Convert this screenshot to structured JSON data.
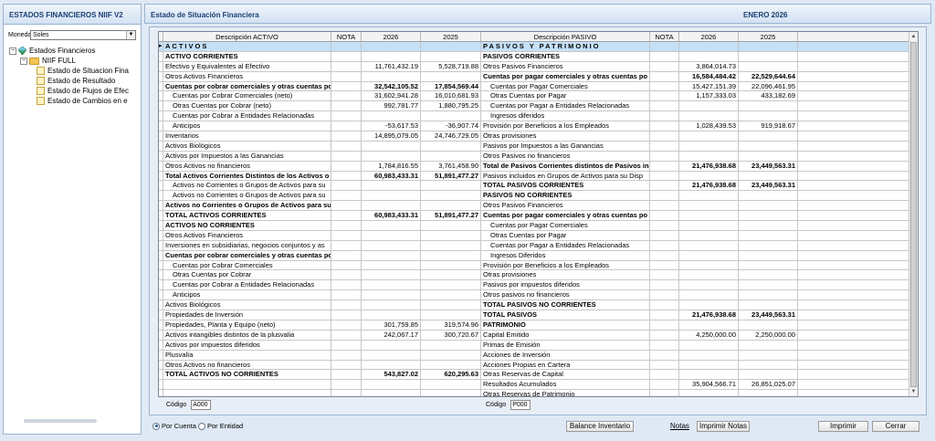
{
  "left_panel": {
    "title": "ESTADOS FINANCIEROS NIIF V2",
    "moneda_label": "Moneda",
    "moneda_value": "Soles",
    "tree": {
      "root": "Estados Financieros",
      "group": "NIIF FULL",
      "items": [
        "Estado de Situacion Fina",
        "Estado de Resultado",
        "Estado de Flujos de Efec",
        "Estado de Cambios en e"
      ]
    }
  },
  "main": {
    "title": "Estado de Situación Financiera",
    "period": "ENERO 2026",
    "headers": [
      "Descripción ACTIVO",
      "NOTA",
      "2026",
      "2025",
      "Descripción PASIVO",
      "NOTA",
      "2026",
      "2025"
    ],
    "rows": [
      {
        "a": "ACTIVOS",
        "a26": "",
        "a25": "",
        "p": "PASIVOS Y PATRIMONIO",
        "p26": "",
        "p25": "",
        "ab": true,
        "pb": true,
        "hl": true
      },
      {
        "a": "ACTIVO CORRIENTES",
        "a26": "",
        "a25": "",
        "p": "PASIVOS CORRIENTES",
        "p26": "",
        "p25": "",
        "ab": true,
        "pb": true
      },
      {
        "a": "Efectivo y Equivalentes al Efectivo",
        "a26": "11,761,432.19",
        "a25": "5,528,719.88",
        "p": "Otros Pasivos Financieros",
        "p26": "3,864,014.73",
        "p25": ""
      },
      {
        "a": "Otros Activos Financieros",
        "a26": "",
        "a25": "",
        "p": "Cuentas por pagar comerciales y otras cuentas po",
        "p26": "16,584,484.42",
        "p25": "22,529,644.64",
        "pb": true
      },
      {
        "a": "Cuentas por cobrar comerciales y otras cuentas po",
        "a26": "32,542,105.52",
        "a25": "17,854,569.44",
        "p": "Cuentas por Pagar Comerciales",
        "p26": "15,427,151.39",
        "p25": "22,096,461.95",
        "ab": true,
        "pi": true
      },
      {
        "a": "Cuentas por Cobrar Comerciales (neto)",
        "a26": "31,602,941.28",
        "a25": "16,010,681.93",
        "p": "Otras Cuentas por Pagar",
        "p26": "1,157,333.03",
        "p25": "433,182.69",
        "ai": true,
        "pi": true
      },
      {
        "a": "Otras Cuentas por Cobrar (neto)",
        "a26": "992,781.77",
        "a25": "1,880,795.25",
        "p": "Cuentas por Pagar a Entidades Relacionadas",
        "p26": "",
        "p25": "",
        "ai": true,
        "pi": true
      },
      {
        "a": "Cuentas por Cobrar a Entidades Relacionadas",
        "a26": "",
        "a25": "",
        "p": "Ingresos diferidos",
        "p26": "",
        "p25": "",
        "ai": true,
        "pi": true
      },
      {
        "a": "Anticipos",
        "a26": "-53,617.53",
        "a25": "-36,907.74",
        "p": "Provisión por Beneficios a los Empleados",
        "p26": "1,028,439.53",
        "p25": "919,918.67",
        "ai": true
      },
      {
        "a": "Inventarios",
        "a26": "14,895,079.05",
        "a25": "24,746,729.05",
        "p": "Otras provisiones",
        "p26": "",
        "p25": ""
      },
      {
        "a": "Activos Biológicos",
        "a26": "",
        "a25": "",
        "p": "Pasivos por Impuestos a las Ganancias",
        "p26": "",
        "p25": ""
      },
      {
        "a": "Activos por Impuestos a las Ganancias",
        "a26": "",
        "a25": "",
        "p": "Otros Pasivos no financieros",
        "p26": "",
        "p25": ""
      },
      {
        "a": "Otros Activos no financieros",
        "a26": "1,784,816.55",
        "a25": "3,761,458.90",
        "p": "Total de Pasivos Corrientes distintos de Pasivos inc",
        "p26": "21,476,938.68",
        "p25": "23,449,563.31",
        "pb": true
      },
      {
        "a": "Total Activos Corrientes Distintos de los Activos o C",
        "a26": "60,983,433.31",
        "a25": "51,891,477.27",
        "p": "Pasivos incluidos en Grupos de Activos para su Disp",
        "p26": "",
        "p25": "",
        "ab": true
      },
      {
        "a": "Activos no Corrientes o Grupos de Activos para su",
        "a26": "",
        "a25": "",
        "p": "TOTAL PASIVOS CORRIENTES",
        "p26": "21,476,938.68",
        "p25": "23,449,563.31",
        "ai": true,
        "pb": true
      },
      {
        "a": "Activos no Corrientes o Grupos de Activos para su",
        "a26": "",
        "a25": "",
        "p": "PASIVOS NO CORRIENTES",
        "p26": "",
        "p25": "",
        "ai": true,
        "pb": true
      },
      {
        "a": "Activos no Corrientes o Grupos de Activos para su",
        "a26": "",
        "a25": "",
        "p": "Otros Pasivos Financieros",
        "p26": "",
        "p25": "",
        "ab": true
      },
      {
        "a": "TOTAL ACTIVOS CORRIENTES",
        "a26": "60,983,433.31",
        "a25": "51,891,477.27",
        "p": "Cuentas por pagar comerciales y otras cuentas po",
        "p26": "",
        "p25": "",
        "ab": true,
        "pb": true
      },
      {
        "a": "ACTIVOS NO CORRIENTES",
        "a26": "",
        "a25": "",
        "p": "Cuentas por Pagar Comerciales",
        "p26": "",
        "p25": "",
        "ab": true,
        "pi": true
      },
      {
        "a": "Otros Activos Financieros",
        "a26": "",
        "a25": "",
        "p": "Otras Cuentas por Pagar",
        "p26": "",
        "p25": "",
        "pi": true
      },
      {
        "a": "Inversiones en subsidiarias, negocios conjuntos y as",
        "a26": "",
        "a25": "",
        "p": "Cuentas por Pagar a Entidades Relacionadas",
        "p26": "",
        "p25": "",
        "pi": true
      },
      {
        "a": "Cuentas por cobrar comerciales y otras cuentas po",
        "a26": "",
        "a25": "",
        "p": "Ingresos Diferidos",
        "p26": "",
        "p25": "",
        "ab": true,
        "pi": true
      },
      {
        "a": "Cuentas por Cobrar Comerciales",
        "a26": "",
        "a25": "",
        "p": "Provisión por Beneficios a los Empleados",
        "p26": "",
        "p25": "",
        "ai": true
      },
      {
        "a": "Otras Cuentas por Cobrar",
        "a26": "",
        "a25": "",
        "p": "Otras provisiones",
        "p26": "",
        "p25": "",
        "ai": true
      },
      {
        "a": "Cuentas por Cobrar a Entidades Relacionadas",
        "a26": "",
        "a25": "",
        "p": "Pasivos por impuestos diferidos",
        "p26": "",
        "p25": "",
        "ai": true
      },
      {
        "a": "Anticipos",
        "a26": "",
        "a25": "",
        "p": "Otros pasivos no financieros",
        "p26": "",
        "p25": "",
        "ai": true
      },
      {
        "a": "Activos Biológicos",
        "a26": "",
        "a25": "",
        "p": "TOTAL PASIVOS NO CORRIENTES",
        "p26": "",
        "p25": "",
        "pb": true
      },
      {
        "a": "Propiedades de Inversión",
        "a26": "",
        "a25": "",
        "p": "TOTAL PASIVOS",
        "p26": "21,476,938.68",
        "p25": "23,449,563.31",
        "pb": true
      },
      {
        "a": "Propiedades, Planta y Equipo (neto)",
        "a26": "301,759.85",
        "a25": "319,574.96",
        "p": "PATRIMONIO",
        "p26": "",
        "p25": "",
        "pb": true
      },
      {
        "a": "Activos intangibles distintos de la plusvalia",
        "a26": "242,067.17",
        "a25": "300,720.67",
        "p": "Capital Emitido",
        "p26": "4,250,000.00",
        "p25": "2,250,000.00"
      },
      {
        "a": "Activos por impuestos diferidos",
        "a26": "",
        "a25": "",
        "p": "Primas de Emisión",
        "p26": "",
        "p25": ""
      },
      {
        "a": "Plusvalía",
        "a26": "",
        "a25": "",
        "p": "Acciones de Inversión",
        "p26": "",
        "p25": ""
      },
      {
        "a": "Otros Activos no financieros",
        "a26": "",
        "a25": "",
        "p": "Acciones Propias en Cartera",
        "p26": "",
        "p25": ""
      },
      {
        "a": "TOTAL ACTIVOS NO CORRIENTES",
        "a26": "543,827.02",
        "a25": "620,295.63",
        "p": "Otras Reservas de Capital",
        "p26": "",
        "p25": "",
        "ab": true
      },
      {
        "a": "",
        "a26": "",
        "a25": "",
        "p": "Resultados Acumulados",
        "p26": "35,904,566.71",
        "p25": "26,851,025.07"
      },
      {
        "a": "",
        "a26": "",
        "a25": "",
        "p": "Otras Reservas de Patrimonio",
        "p26": "",
        "p25": ""
      }
    ],
    "codigo_label": "Código",
    "codigo_activo": "A000",
    "codigo_pasivo": "P000"
  },
  "footer": {
    "radio_cuenta": "Por Cuenta",
    "radio_entidad": "Por Entidad",
    "balance_btn": "Balance Inventario",
    "notas_btn": "Notas",
    "imprimir_notas_btn": "Imprimir Notas",
    "imprimir_btn": "Imprimir",
    "cerrar_btn": "Cerrar"
  }
}
